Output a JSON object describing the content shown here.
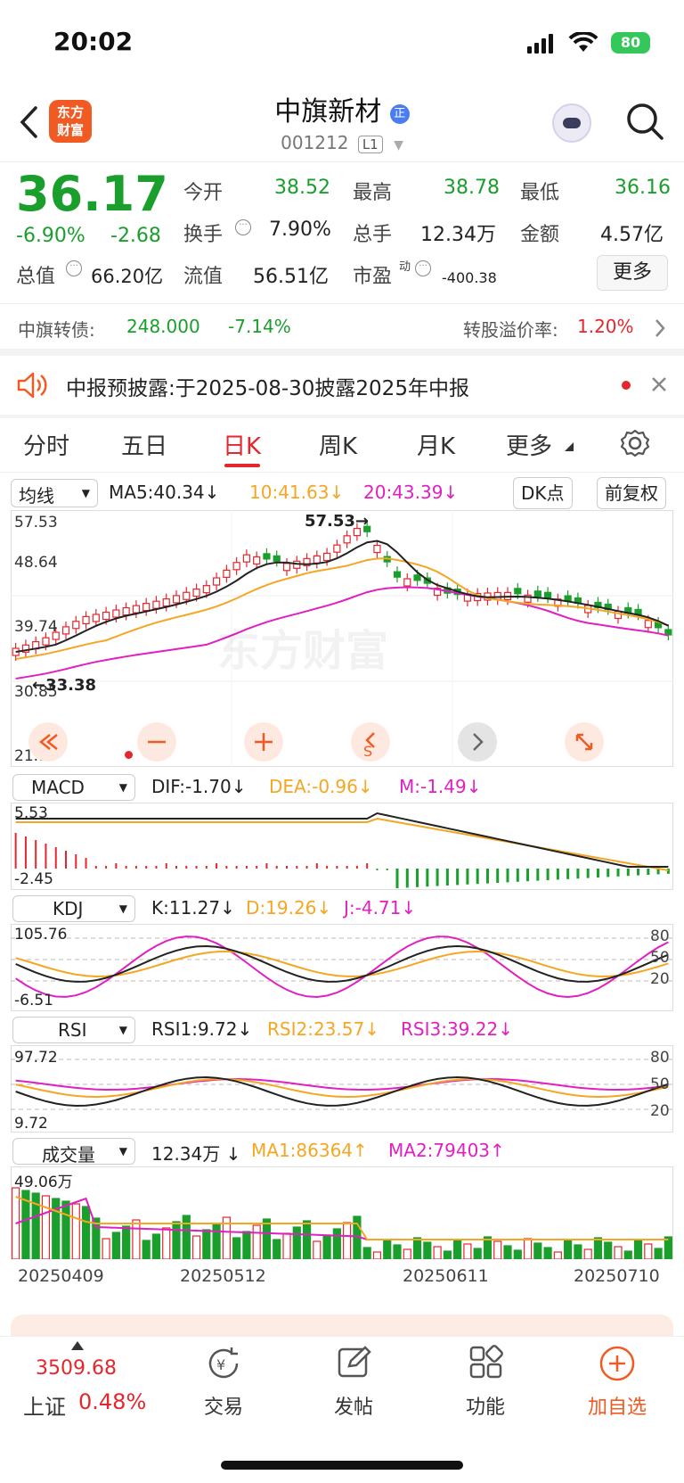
{
  "status_bar": {
    "time": "20:02",
    "battery": "80"
  },
  "header": {
    "logo_line1": "东方",
    "logo_line2": "财富",
    "stock_name": "中旗新材",
    "stock_code": "001212",
    "level": "L1"
  },
  "quote": {
    "price": "36.17",
    "change_pct": "-6.90%",
    "change_abs": "-2.68",
    "labels": {
      "open": "今开",
      "high": "最高",
      "low": "最低",
      "turnover": "换手",
      "volume": "总手",
      "amount": "金额",
      "mktcap": "总值",
      "float_cap": "流值",
      "pe": "市盈",
      "pe_sup": "动"
    },
    "open": "38.52",
    "high": "38.78",
    "low": "36.16",
    "turnover": "7.90%",
    "volume": "12.34万",
    "amount": "4.57亿",
    "mktcap": "66.20亿",
    "float_cap": "56.51亿",
    "pe": "-400.38",
    "more": "更多"
  },
  "bond": {
    "name": "中旗转债:",
    "price": "248.000",
    "pct": "-7.14%",
    "premium_label": "转股溢价率:",
    "premium": "1.20%"
  },
  "notice": {
    "text": "中报预披露:于2025-08-30披露2025年中报"
  },
  "tabs": [
    {
      "label": "分时"
    },
    {
      "label": "五日"
    },
    {
      "label": "日K"
    },
    {
      "label": "周K"
    },
    {
      "label": "月K"
    },
    {
      "label": "更多"
    }
  ],
  "ma_bar": {
    "selector": "均线",
    "ma5": "MA5:40.34",
    "ma10": "10:41.63",
    "ma20": "20:43.39",
    "dk": "DK点",
    "fq": "前复权"
  },
  "kline": {
    "y_labels": [
      "57.53",
      "48.64",
      "39.74",
      "30.85",
      "21.95"
    ],
    "peak_label": "57.53→",
    "low_label": "←33.38",
    "watermark": "东方财富"
  },
  "macd": {
    "selector": "MACD",
    "dif": "DIF:-1.70",
    "dea": "DEA:-0.96",
    "m": "M:-1.49",
    "top": "5.53",
    "bottom": "-2.45"
  },
  "kdj": {
    "selector": "KDJ",
    "k": "K:11.27",
    "d": "D:19.26",
    "j": "J:-4.71",
    "top": "105.76",
    "bottom": "-6.51",
    "levels": [
      "80",
      "50",
      "20"
    ]
  },
  "rsi": {
    "selector": "RSI",
    "r1": "RSI1:9.72",
    "r2": "RSI2:23.57",
    "r3": "RSI3:39.22",
    "top": "97.72",
    "bottom": "9.72",
    "levels": [
      "80",
      "50",
      "20"
    ]
  },
  "volume": {
    "selector": "成交量",
    "vol": "12.34万",
    "ma1": "MA1:86364",
    "ma2": "MA2:79403",
    "top": "49.06万"
  },
  "dates": [
    "20250409",
    "20250512",
    "20250611",
    "20250710"
  ],
  "bottom_nav": {
    "index_value": "3509.68",
    "index_name": "上证",
    "index_pct": "0.48%",
    "trade": "交易",
    "post": "发帖",
    "func": "功能",
    "add": "加自选"
  },
  "colors": {
    "up": "#e4262d",
    "down": "#1a9e2c",
    "accent": "#f15a22",
    "ma10": "#f5a623",
    "ma20": "#e020c0"
  }
}
